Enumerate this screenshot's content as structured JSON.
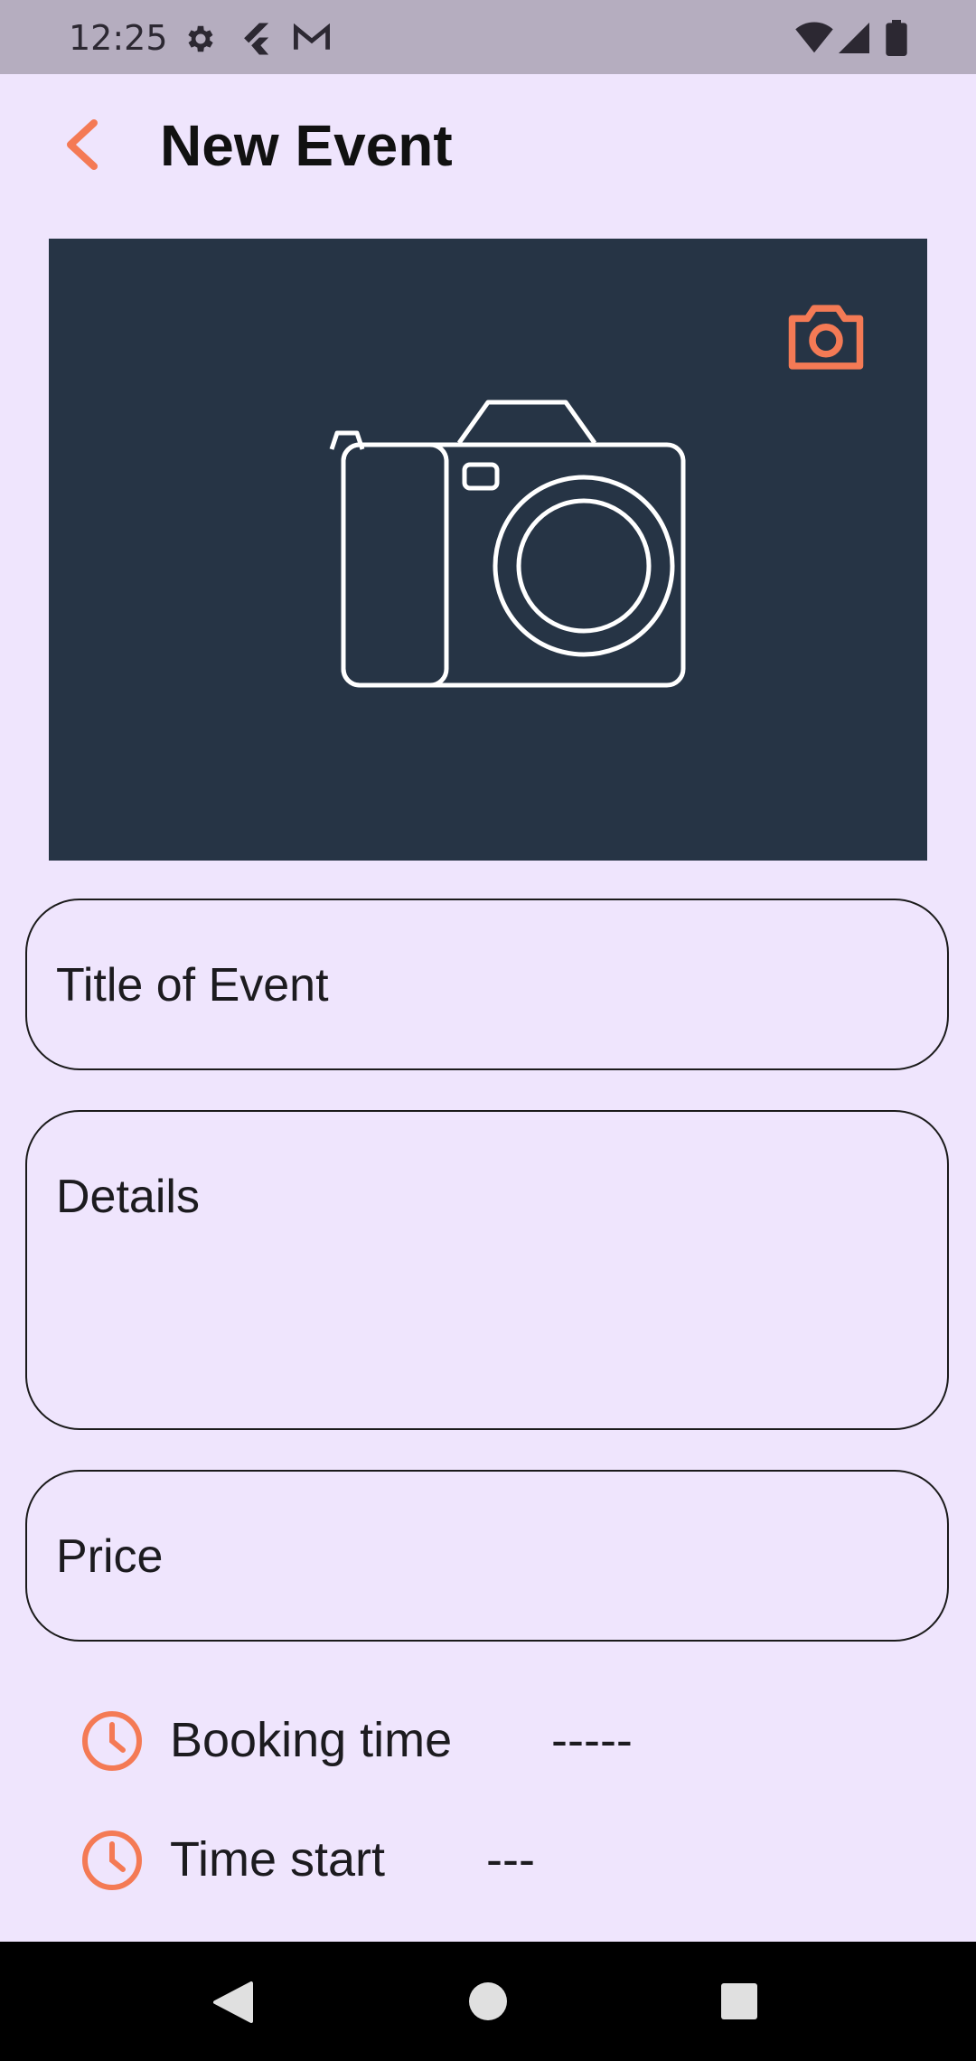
{
  "status_bar": {
    "time": "12:25",
    "icons_left": [
      "gear-icon",
      "flutter-icon",
      "gmail-icon"
    ],
    "icons_right": [
      "wifi-icon",
      "signal-icon",
      "battery-icon"
    ]
  },
  "app_bar": {
    "title": "New Event",
    "back_icon": "chevron-left-icon"
  },
  "image_panel": {
    "background": "#263445",
    "change_photo_icon": "camera-outline-icon",
    "placeholder_icon": "camera-placeholder-icon"
  },
  "form": {
    "title_placeholder": "Title of Event",
    "details_placeholder": "Details",
    "price_placeholder": "Price"
  },
  "times": {
    "booking_label": "Booking time",
    "booking_value": "-----",
    "start_label": "Time start",
    "start_value": "---"
  },
  "colors": {
    "accent": "#f47a55",
    "background": "#efe5fd",
    "status_bar": "#b5adbf",
    "image_bg": "#263445"
  },
  "nav_bar": {
    "icons": [
      "back-triangle-icon",
      "home-circle-icon",
      "recents-square-icon"
    ]
  }
}
